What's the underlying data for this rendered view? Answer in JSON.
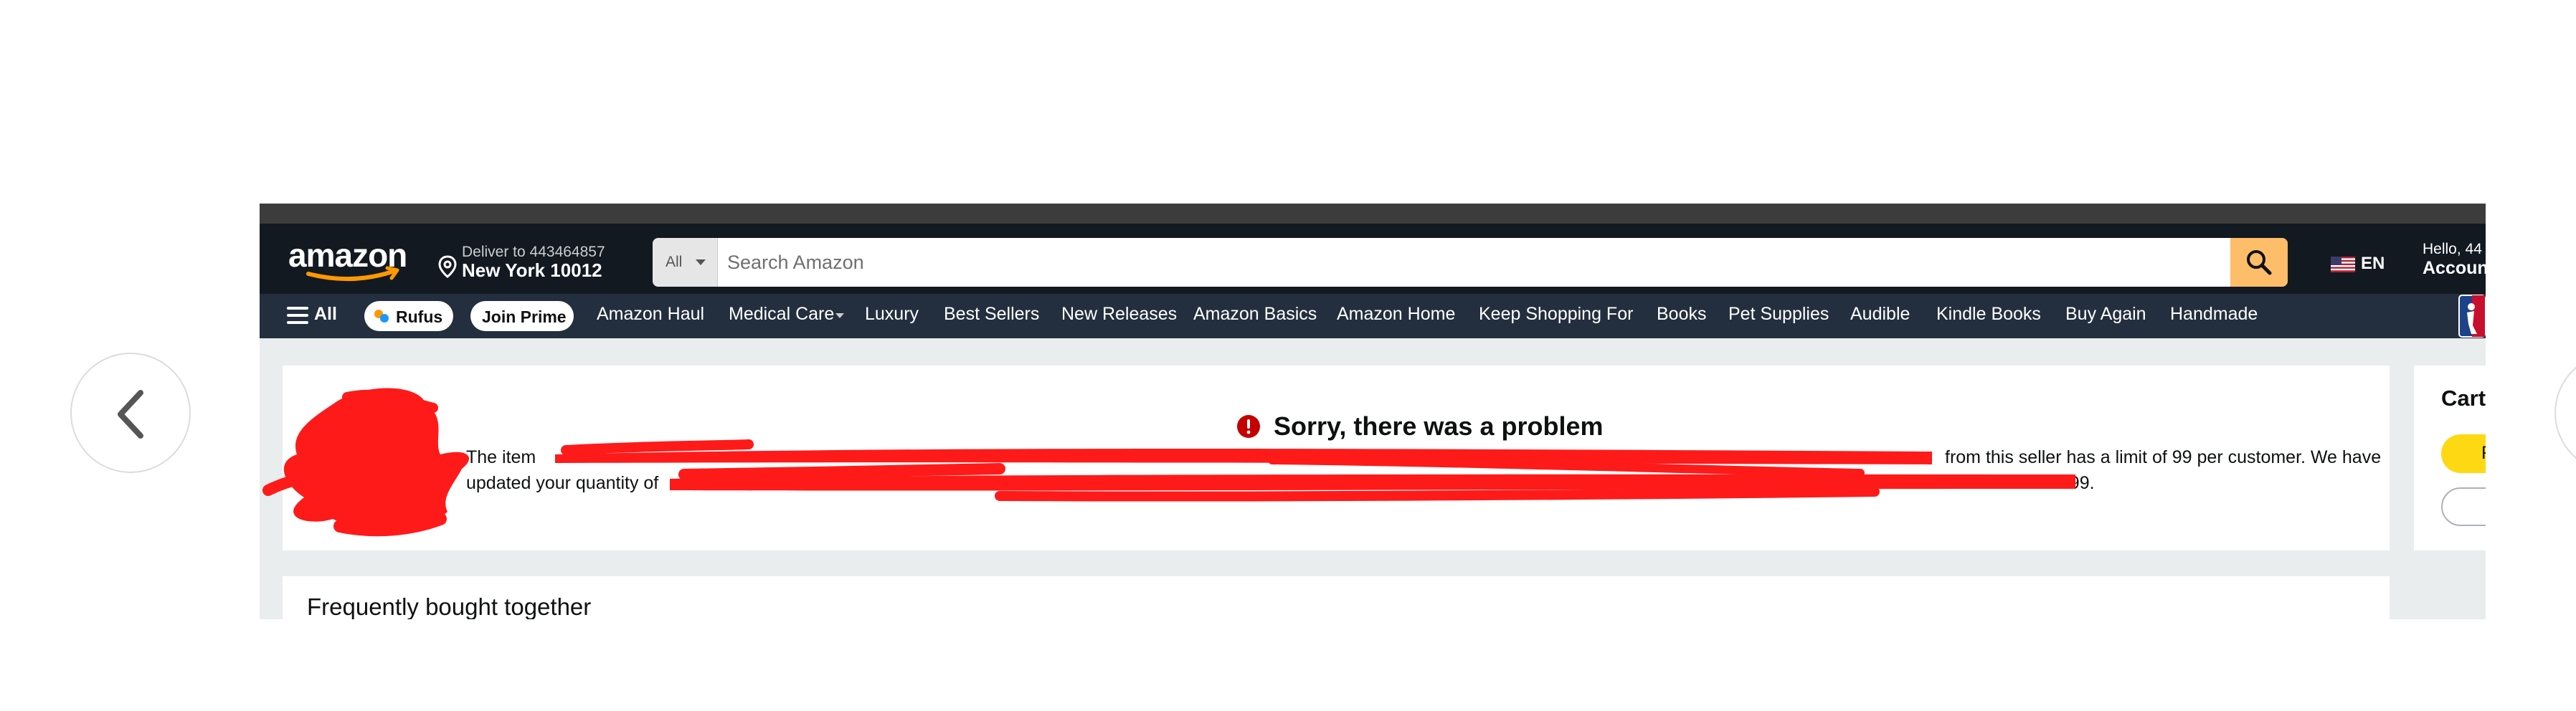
{
  "header": {
    "logo_text": "amazon",
    "deliver_line": "Deliver to 443464857",
    "city_line": "New York 10012",
    "search": {
      "category": "All",
      "placeholder": "Search Amazon"
    },
    "language": "EN",
    "hello_line": "Hello, 44",
    "account_line": "Accoun"
  },
  "nav": {
    "all_label": "All",
    "rufus_label": "Rufus",
    "join_prime_label": "Join Prime",
    "items": [
      "Amazon Haul",
      "Medical Care",
      "Luxury",
      "Best Sellers",
      "New Releases",
      "Amazon Basics",
      "Amazon Home",
      "Keep Shopping For",
      "Books",
      "Pet Supplies",
      "Audible",
      "Kindle Books",
      "Buy Again",
      "Handmade"
    ]
  },
  "error": {
    "title": "Sorry, there was a problem",
    "message_line1_start": "The item",
    "message_line1_end": "from this seller has a limit of 99 per customer. We have",
    "message_line2_start": "updated your quantity of",
    "message_line2_end": "to 99."
  },
  "cart": {
    "title": "Cart",
    "button1_label": "F"
  },
  "fbt": {
    "title": "Frequently bought together"
  },
  "colors": {
    "header_bg": "#131921",
    "nav_bg": "#232f3e",
    "search_button": "#febd69",
    "error_icon": "#c40000",
    "redaction": "#ff1a1a",
    "cart_button": "#ffd814"
  }
}
